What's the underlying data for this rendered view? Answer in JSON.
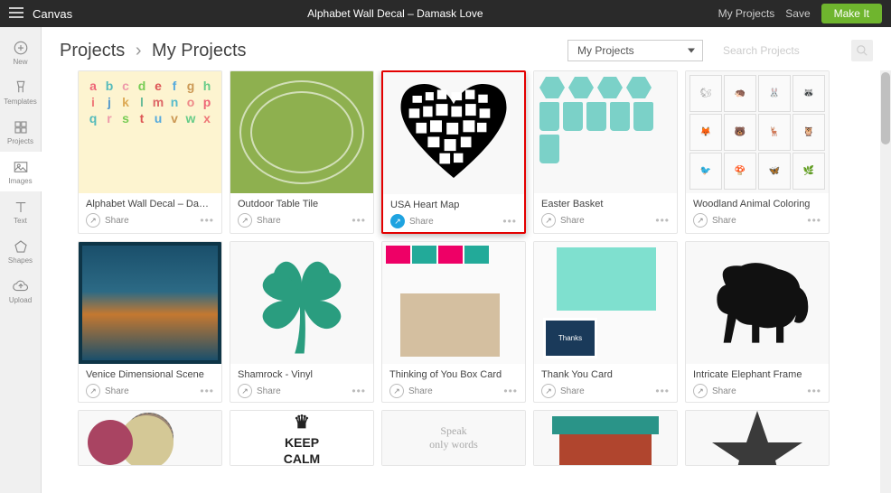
{
  "topbar": {
    "canvas": "Canvas",
    "title": "Alphabet Wall Decal – Damask Love",
    "myProjects": "My Projects",
    "save": "Save",
    "makeIt": "Make It"
  },
  "sidebar": {
    "tools": [
      {
        "id": "new",
        "label": "New"
      },
      {
        "id": "templates",
        "label": "Templates"
      },
      {
        "id": "projects",
        "label": "Projects"
      },
      {
        "id": "images",
        "label": "Images"
      },
      {
        "id": "text",
        "label": "Text"
      },
      {
        "id": "shapes",
        "label": "Shapes"
      },
      {
        "id": "upload",
        "label": "Upload"
      }
    ]
  },
  "breadcrumb": {
    "root": "Projects",
    "current": "My Projects"
  },
  "dropdown": {
    "selected": "My Projects"
  },
  "search": {
    "placeholder": "Search Projects"
  },
  "shareLabel": "Share",
  "projects": [
    {
      "title": "Alphabet Wall Decal – Damask",
      "thumb": "alphabet",
      "shared": false,
      "highlighted": false
    },
    {
      "title": "Outdoor Table Tile",
      "thumb": "tile",
      "shared": false,
      "highlighted": false
    },
    {
      "title": "USA Heart Map",
      "thumb": "heart",
      "shared": true,
      "highlighted": true
    },
    {
      "title": "Easter Basket",
      "thumb": "basket",
      "shared": false,
      "highlighted": false
    },
    {
      "title": "Woodland Animal Coloring",
      "thumb": "woodland",
      "shared": false,
      "highlighted": false
    },
    {
      "title": "Venice Dimensional Scene",
      "thumb": "venice",
      "shared": false,
      "highlighted": false
    },
    {
      "title": "Shamrock - Vinyl",
      "thumb": "shamrock",
      "shared": false,
      "highlighted": false
    },
    {
      "title": "Thinking of You Box Card",
      "thumb": "boxcard",
      "shared": false,
      "highlighted": false
    },
    {
      "title": "Thank You Card",
      "thumb": "thankyou",
      "shared": false,
      "highlighted": false
    },
    {
      "title": "Intricate Elephant Frame",
      "thumb": "elephant",
      "shared": false,
      "highlighted": false
    }
  ],
  "partialRow": [
    {
      "thumb": "circles"
    },
    {
      "thumb": "keepcalm"
    },
    {
      "thumb": "speak"
    },
    {
      "thumb": "pot"
    },
    {
      "thumb": "star"
    }
  ],
  "keepCalm": {
    "line1": "KEEP",
    "line2": "CALM"
  }
}
